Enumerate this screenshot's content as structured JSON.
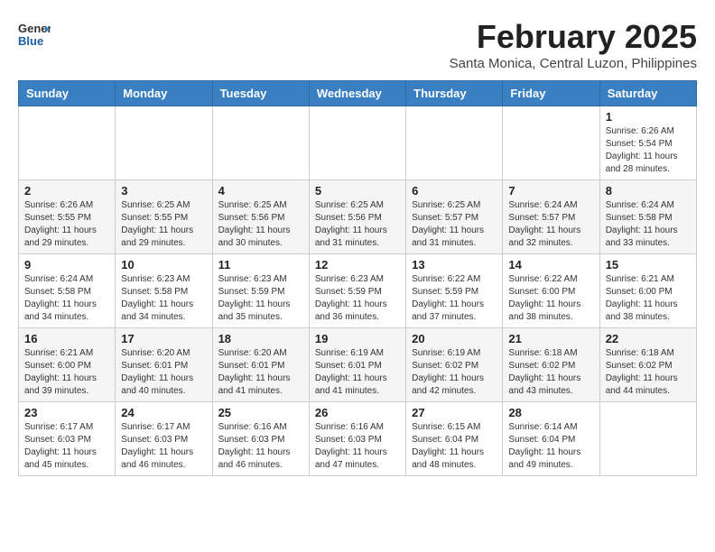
{
  "header": {
    "logo_general": "General",
    "logo_blue": "Blue",
    "month_title": "February 2025",
    "location": "Santa Monica, Central Luzon, Philippines"
  },
  "days_of_week": [
    "Sunday",
    "Monday",
    "Tuesday",
    "Wednesday",
    "Thursday",
    "Friday",
    "Saturday"
  ],
  "weeks": [
    [
      {
        "day": "",
        "info": ""
      },
      {
        "day": "",
        "info": ""
      },
      {
        "day": "",
        "info": ""
      },
      {
        "day": "",
        "info": ""
      },
      {
        "day": "",
        "info": ""
      },
      {
        "day": "",
        "info": ""
      },
      {
        "day": "1",
        "info": "Sunrise: 6:26 AM\nSunset: 5:54 PM\nDaylight: 11 hours and 28 minutes."
      }
    ],
    [
      {
        "day": "2",
        "info": "Sunrise: 6:26 AM\nSunset: 5:55 PM\nDaylight: 11 hours and 29 minutes."
      },
      {
        "day": "3",
        "info": "Sunrise: 6:25 AM\nSunset: 5:55 PM\nDaylight: 11 hours and 29 minutes."
      },
      {
        "day": "4",
        "info": "Sunrise: 6:25 AM\nSunset: 5:56 PM\nDaylight: 11 hours and 30 minutes."
      },
      {
        "day": "5",
        "info": "Sunrise: 6:25 AM\nSunset: 5:56 PM\nDaylight: 11 hours and 31 minutes."
      },
      {
        "day": "6",
        "info": "Sunrise: 6:25 AM\nSunset: 5:57 PM\nDaylight: 11 hours and 31 minutes."
      },
      {
        "day": "7",
        "info": "Sunrise: 6:24 AM\nSunset: 5:57 PM\nDaylight: 11 hours and 32 minutes."
      },
      {
        "day": "8",
        "info": "Sunrise: 6:24 AM\nSunset: 5:58 PM\nDaylight: 11 hours and 33 minutes."
      }
    ],
    [
      {
        "day": "9",
        "info": "Sunrise: 6:24 AM\nSunset: 5:58 PM\nDaylight: 11 hours and 34 minutes."
      },
      {
        "day": "10",
        "info": "Sunrise: 6:23 AM\nSunset: 5:58 PM\nDaylight: 11 hours and 34 minutes."
      },
      {
        "day": "11",
        "info": "Sunrise: 6:23 AM\nSunset: 5:59 PM\nDaylight: 11 hours and 35 minutes."
      },
      {
        "day": "12",
        "info": "Sunrise: 6:23 AM\nSunset: 5:59 PM\nDaylight: 11 hours and 36 minutes."
      },
      {
        "day": "13",
        "info": "Sunrise: 6:22 AM\nSunset: 5:59 PM\nDaylight: 11 hours and 37 minutes."
      },
      {
        "day": "14",
        "info": "Sunrise: 6:22 AM\nSunset: 6:00 PM\nDaylight: 11 hours and 38 minutes."
      },
      {
        "day": "15",
        "info": "Sunrise: 6:21 AM\nSunset: 6:00 PM\nDaylight: 11 hours and 38 minutes."
      }
    ],
    [
      {
        "day": "16",
        "info": "Sunrise: 6:21 AM\nSunset: 6:00 PM\nDaylight: 11 hours and 39 minutes."
      },
      {
        "day": "17",
        "info": "Sunrise: 6:20 AM\nSunset: 6:01 PM\nDaylight: 11 hours and 40 minutes."
      },
      {
        "day": "18",
        "info": "Sunrise: 6:20 AM\nSunset: 6:01 PM\nDaylight: 11 hours and 41 minutes."
      },
      {
        "day": "19",
        "info": "Sunrise: 6:19 AM\nSunset: 6:01 PM\nDaylight: 11 hours and 41 minutes."
      },
      {
        "day": "20",
        "info": "Sunrise: 6:19 AM\nSunset: 6:02 PM\nDaylight: 11 hours and 42 minutes."
      },
      {
        "day": "21",
        "info": "Sunrise: 6:18 AM\nSunset: 6:02 PM\nDaylight: 11 hours and 43 minutes."
      },
      {
        "day": "22",
        "info": "Sunrise: 6:18 AM\nSunset: 6:02 PM\nDaylight: 11 hours and 44 minutes."
      }
    ],
    [
      {
        "day": "23",
        "info": "Sunrise: 6:17 AM\nSunset: 6:03 PM\nDaylight: 11 hours and 45 minutes."
      },
      {
        "day": "24",
        "info": "Sunrise: 6:17 AM\nSunset: 6:03 PM\nDaylight: 11 hours and 46 minutes."
      },
      {
        "day": "25",
        "info": "Sunrise: 6:16 AM\nSunset: 6:03 PM\nDaylight: 11 hours and 46 minutes."
      },
      {
        "day": "26",
        "info": "Sunrise: 6:16 AM\nSunset: 6:03 PM\nDaylight: 11 hours and 47 minutes."
      },
      {
        "day": "27",
        "info": "Sunrise: 6:15 AM\nSunset: 6:04 PM\nDaylight: 11 hours and 48 minutes."
      },
      {
        "day": "28",
        "info": "Sunrise: 6:14 AM\nSunset: 6:04 PM\nDaylight: 11 hours and 49 minutes."
      },
      {
        "day": "",
        "info": ""
      }
    ]
  ]
}
